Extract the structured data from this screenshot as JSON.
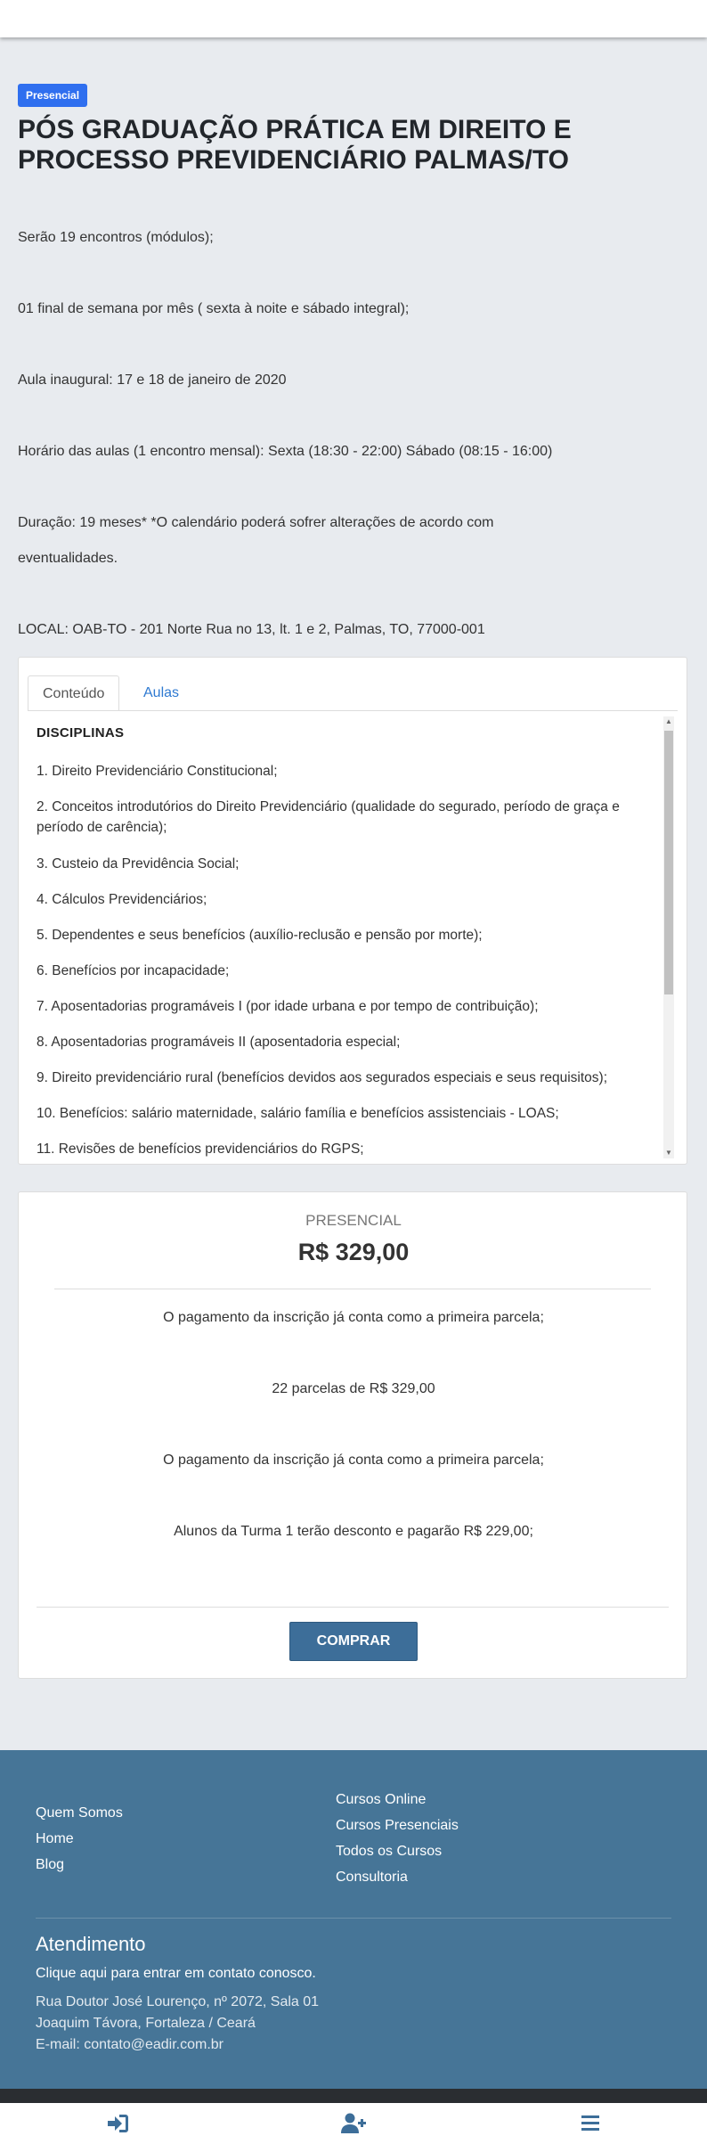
{
  "course": {
    "badge": "Presencial",
    "title": "PÓS GRADUAÇÃO PRÁTICA EM DIREITO E PROCESSO PREVIDENCIÁRIO PALMAS/TO",
    "info": [
      "Serão 19 encontros (módulos);",
      "01 final de semana por mês ( sexta à noite e sábado integral);",
      "Aula inaugural: 17 e 18 de janeiro de 2020",
      "Horário das aulas (1 encontro mensal): Sexta (18:30 - 22:00) Sábado (08:15 - 16:00)",
      "Duração: 19 meses* *O calendário poderá sofrer alterações de acordo com",
      "eventualidades.",
      "LOCAL: OAB-TO - 201 Norte Rua no 13, lt. 1 e 2, Palmas, TO, 77000-001"
    ]
  },
  "tabs": {
    "items": [
      {
        "label": "Conteúdo",
        "active": true
      },
      {
        "label": "Aulas",
        "active": false
      }
    ],
    "content": {
      "heading": "DISCIPLINAS",
      "items": [
        "1. Direito Previdenciário Constitucional;",
        "2. Conceitos introdutórios do Direito Previdenciário (qualidade do segurado, período de graça e período de carência);",
        "3. Custeio da Previdência Social;",
        "4. Cálculos Previdenciários;",
        "5. Dependentes e seus benefícios (auxílio-reclusão e pensão por morte);",
        "6. Benefícios por incapacidade;",
        "7. Aposentadorias programáveis I (por idade urbana e por tempo de contribuição);",
        "8. Aposentadorias programáveis II (aposentadoria especial;",
        "9. Direito previdenciário rural (benefícios devidos aos segurados especiais e seus requisitos);",
        "10. Benefícios: salário maternidade, salário família e benefícios assistenciais - LOAS;",
        "11. Revisões de benefícios previdenciários do RGPS;"
      ]
    }
  },
  "pricing": {
    "label": "PRESENCIAL",
    "price": "R$ 329,00",
    "lines": [
      "O pagamento da inscrição já conta como a primeira parcela;",
      "22 parcelas de R$ 329,00",
      "O pagamento da inscrição já conta como a primeira parcela;",
      "Alunos da Turma 1 terão desconto e pagarão R$ 229,00;"
    ],
    "buy_label": "COMPRAR"
  },
  "footer": {
    "links_left": [
      "Quem Somos",
      "Home",
      "Blog"
    ],
    "links_right": [
      "Cursos Online",
      "Cursos Presenciais",
      "Todos os Cursos",
      "Consultoria"
    ],
    "attendance_title": "Atendimento",
    "contact_link": "Clique aqui para entrar em contato conosco.",
    "address_lines": [
      "Rua Doutor José Lourenço, nº 2072, Sala 01",
      "Joaquim Távora, Fortaleza / Ceará",
      "E-mail: contato@eadir.com.br"
    ]
  },
  "bottom_nav": {
    "icons": [
      "sign-in-icon",
      "user-plus-icon",
      "menu-icon"
    ],
    "icon_color": "#3d6e99"
  },
  "colors": {
    "badge": "#2f6fef",
    "link": "#2f7ad1",
    "button": "#3d6e99",
    "footer": "#467597"
  }
}
